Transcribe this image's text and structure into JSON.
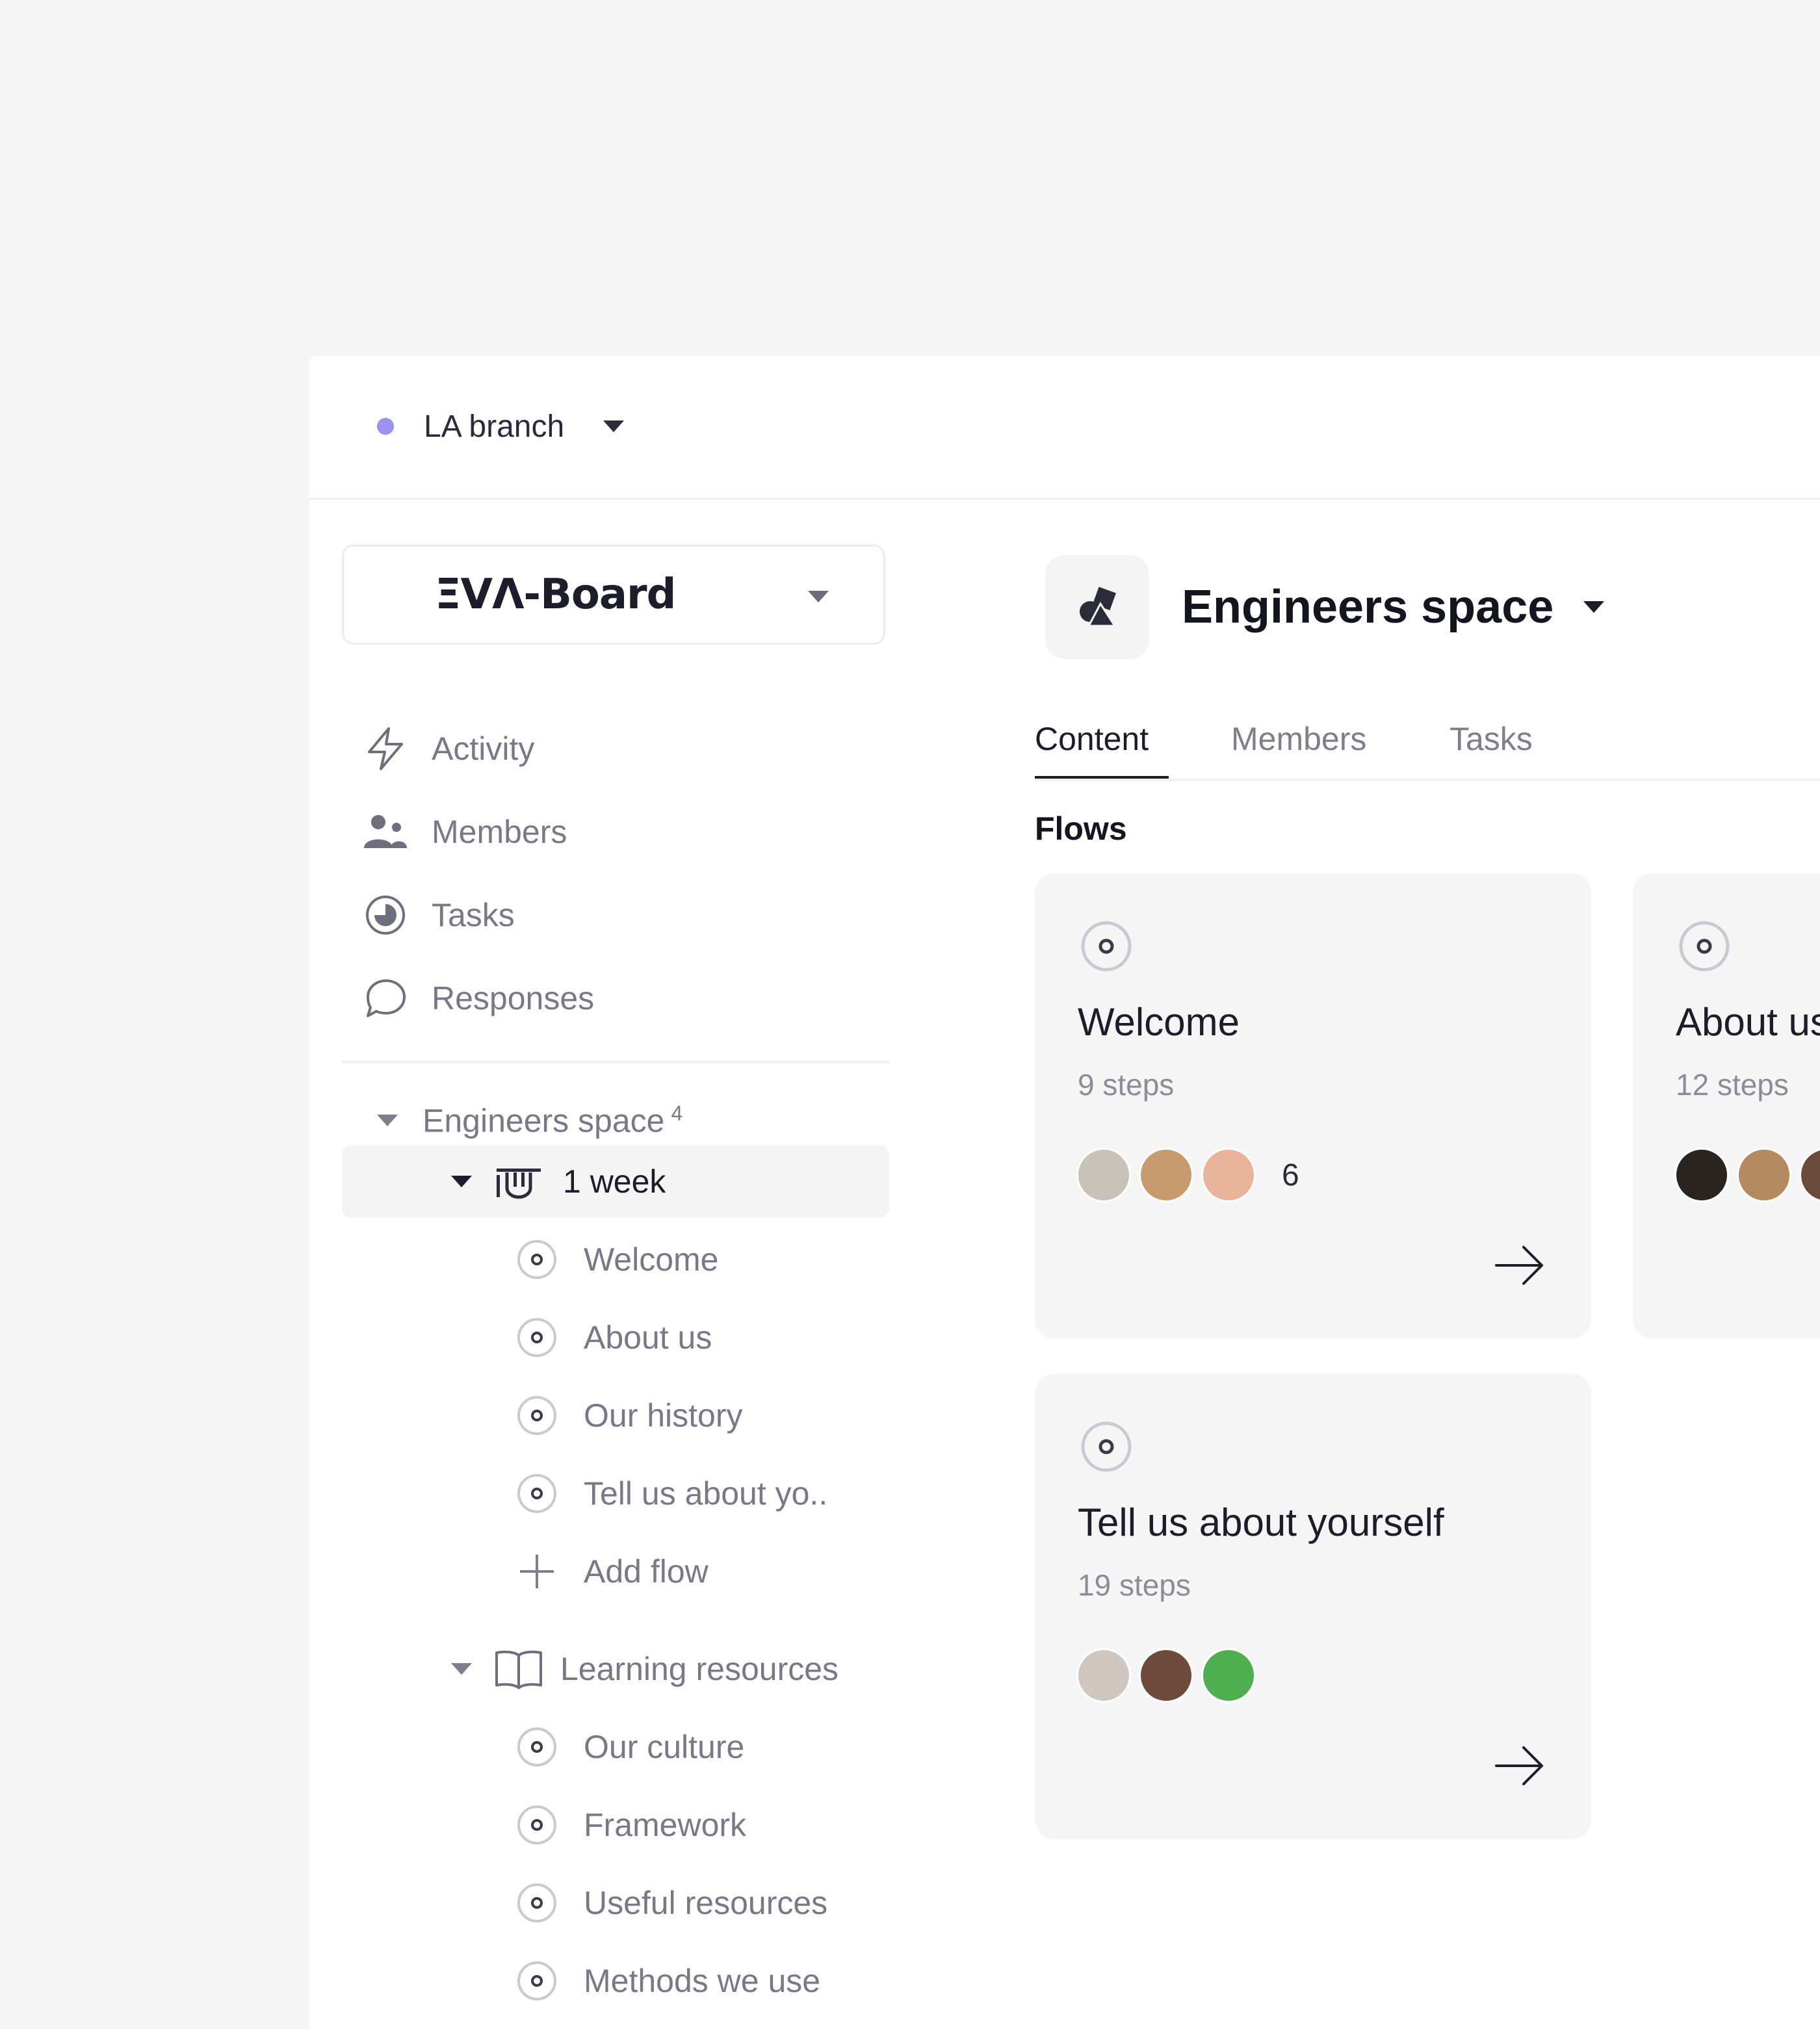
{
  "branch": {
    "name": "LA branch",
    "dot_color": "#9b92f0"
  },
  "org": {
    "logo": "ΞVΛ-Board"
  },
  "nav": [
    {
      "label": "Activity",
      "icon": "lightning-icon"
    },
    {
      "label": "Members",
      "icon": "members-icon"
    },
    {
      "label": "Tasks",
      "icon": "tasks-icon"
    },
    {
      "label": "Responses",
      "icon": "chat-bubble-icon"
    }
  ],
  "tree": {
    "space": {
      "label": "Engineers space",
      "count": "4"
    },
    "group1": {
      "label": "1 week",
      "icon": "week-icon"
    },
    "group1_flows": [
      "Welcome",
      "About us",
      "Our history",
      "Tell us about yo.."
    ],
    "add_flow": "Add flow",
    "group2": {
      "label": "Learning resources",
      "icon": "book-icon"
    },
    "group2_flows": [
      "Our culture",
      "Framework",
      "Useful resources",
      "Methods we use"
    ]
  },
  "main": {
    "space_title": "Engineers space",
    "tabs": [
      "Content",
      "Members",
      "Tasks"
    ],
    "active_tab": "Content",
    "section_title": "Flows",
    "cards": [
      {
        "title": "Welcome",
        "steps": "9 steps",
        "extra_count": "6",
        "avatar_colors": [
          "#c9c2b9",
          "#c89b6e",
          "#e9b39a"
        ]
      },
      {
        "title": "About us",
        "steps": "12 steps",
        "extra_count": "",
        "avatar_colors": [
          "#2a2420",
          "#b58a60",
          "#6a4a3a"
        ]
      },
      {
        "title": "Tell us about yourself",
        "steps": "19 steps",
        "extra_count": "",
        "avatar_colors": [
          "#cfc6bf",
          "#6d4a3a",
          "#4caf50"
        ]
      }
    ]
  },
  "colors": {
    "accent_dot": "#9b92f0",
    "text_primary": "#1c1c2b",
    "text_muted": "#787888",
    "card_bg": "#f5f5f5"
  }
}
